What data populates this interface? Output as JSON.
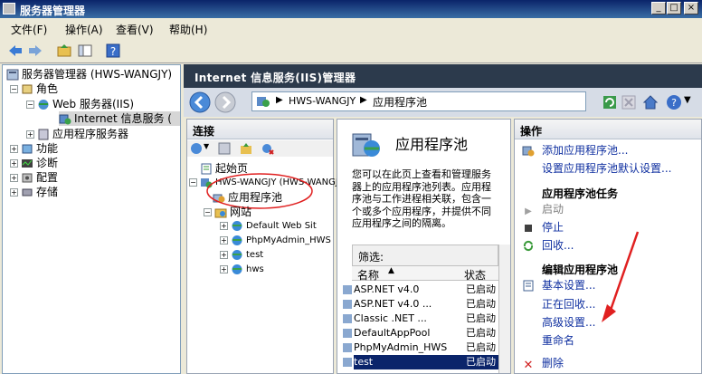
{
  "window": {
    "title": "服务器管理器"
  },
  "menu": [
    "文件(F)",
    "操作(A)",
    "查看(V)",
    "帮助(H)"
  ],
  "tree": {
    "root": "服务器管理器 (HWS-WANGJY)",
    "roles": "角色",
    "web": "Web 服务器(IIS)",
    "iis": "Internet 信息服务 (",
    "appserver": "应用程序服务器",
    "features": "功能",
    "diagnostics": "诊断",
    "config": "配置",
    "storage": "存储"
  },
  "main": {
    "header": "Internet 信息服务(IIS)管理器"
  },
  "address": {
    "server": "HWS-WANGJY",
    "page": "应用程序池"
  },
  "connections": {
    "header": "连接",
    "start": "起始页",
    "server": "HWS-WANGJY (HWS-WANGJY",
    "apppools": "应用程序池",
    "sites": "网站",
    "site_items": [
      "Default Web Sit",
      "PhpMyAdmin_HWS",
      "test",
      "hws"
    ]
  },
  "center": {
    "title": "应用程序池",
    "description": "您可以在此页上查看和管理服务器上的应用程序池列表。应用程序池与工作进程相关联，包含一个或多个应用程序，并提供不同应用程序之间的隔离。",
    "filter_label": "筛选:",
    "col_name": "名称",
    "col_status": "状态",
    "rows": [
      {
        "name": "ASP.NET v4.0",
        "status": "已启动"
      },
      {
        "name": "ASP.NET v4.0 ...",
        "status": "已启动"
      },
      {
        "name": "Classic .NET ...",
        "status": "已启动"
      },
      {
        "name": "DefaultAppPool",
        "status": "已启动"
      },
      {
        "name": "PhpMyAdmin_HWS",
        "status": "已启动"
      },
      {
        "name": "test",
        "status": "已启动"
      }
    ]
  },
  "actions": {
    "header": "操作",
    "add_pool": "添加应用程序池...",
    "set_defaults": "设置应用程序池默认设置...",
    "tasks_header": "应用程序池任务",
    "start": "启动",
    "stop": "停止",
    "recycle": "回收...",
    "edit_header": "编辑应用程序池",
    "basic": "基本设置...",
    "recycling": "正在回收...",
    "advanced": "高级设置...",
    "rename": "重命名",
    "delete": "删除"
  },
  "colors": {
    "title_bar": "#0a246a",
    "header_dark": "#2c3a4c",
    "selection": "#0a246a",
    "annotation_red": "#e02020"
  }
}
